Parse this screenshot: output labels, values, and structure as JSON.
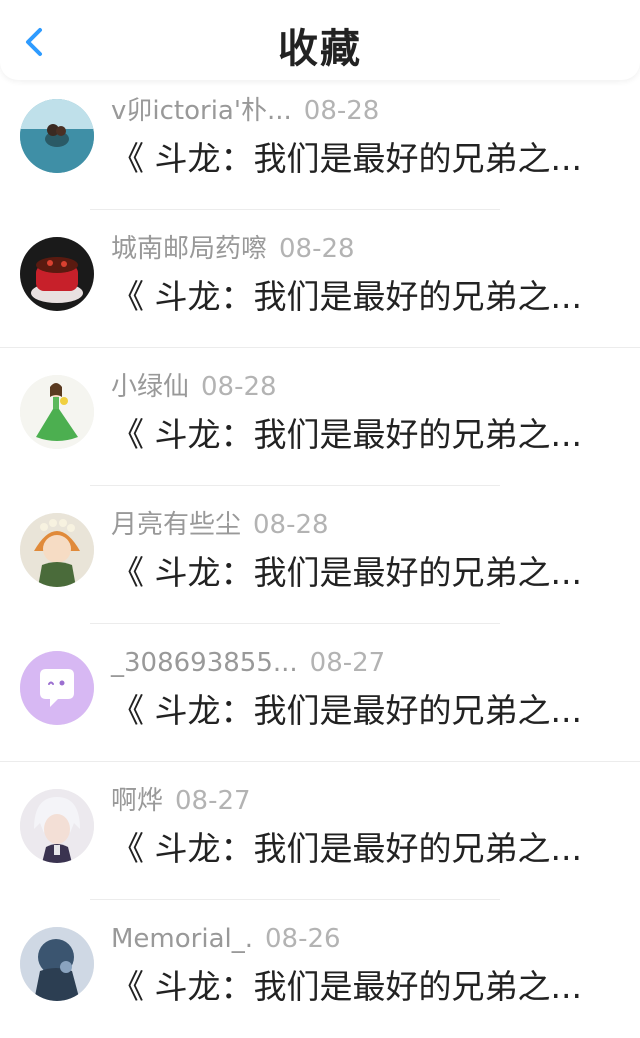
{
  "header": {
    "title": "收藏",
    "back_icon": "chevron-left-icon",
    "accent_color": "#2e9bff"
  },
  "items": [
    {
      "username": "v卯ictoria'朴...",
      "date": "08-28",
      "content": "《 斗龙：我们是最好的兄弟之...",
      "avatar": "photo-person-in-water"
    },
    {
      "username": "城南邮局药嚓",
      "date": "08-28",
      "content": "《 斗龙：我们是最好的兄弟之...",
      "avatar": "photo-red-tea-cup"
    },
    {
      "username": "小绿仙",
      "date": "08-28",
      "content": "《 斗龙：我们是最好的兄弟之...",
      "avatar": "illustration-girl-green-dress"
    },
    {
      "username": "月亮有些尘",
      "date": "08-28",
      "content": "《 斗龙：我们是最好的兄弟之...",
      "avatar": "illustration-flower-crown-boy"
    },
    {
      "username": "_308693855...",
      "date": "08-27",
      "content": "《 斗龙：我们是最好的兄弟之...",
      "avatar": "default-chat-bubble-purple"
    },
    {
      "username": "啊烨",
      "date": "08-27",
      "content": "《 斗龙：我们是最好的兄弟之...",
      "avatar": "illustration-white-hair-boy"
    },
    {
      "username": "Memorial_.",
      "date": "08-26",
      "content": "《 斗龙：我们是最好的兄弟之...",
      "avatar": "photo-dark-blue-figure"
    }
  ]
}
